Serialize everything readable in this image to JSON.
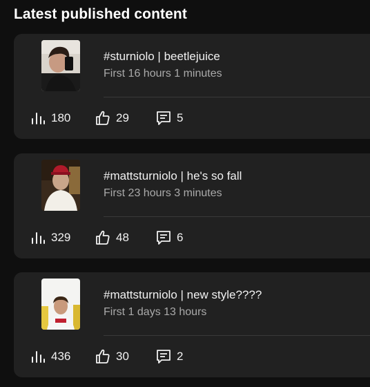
{
  "header": {
    "title": "Latest published content"
  },
  "icons": {
    "views": "bar-chart-icon",
    "likes": "thumbs-up-icon",
    "comments": "comment-icon"
  },
  "colors": {
    "background": "#0f0f0f",
    "card": "#212121",
    "text": "#f1f1f1",
    "subtext": "#aaaaaa"
  },
  "videos": [
    {
      "title": "#sturniolo | beetlejuice",
      "subtitle": "First 16 hours 1 minutes",
      "views": "180",
      "likes": "29",
      "comments": "5"
    },
    {
      "title": "#mattsturniolo | he's so fall",
      "subtitle": "First 23 hours 3 minutes",
      "views": "329",
      "likes": "48",
      "comments": "6"
    },
    {
      "title": "#mattsturniolo | new style????",
      "subtitle": "First 1 days 13 hours",
      "views": "436",
      "likes": "30",
      "comments": "2"
    }
  ]
}
